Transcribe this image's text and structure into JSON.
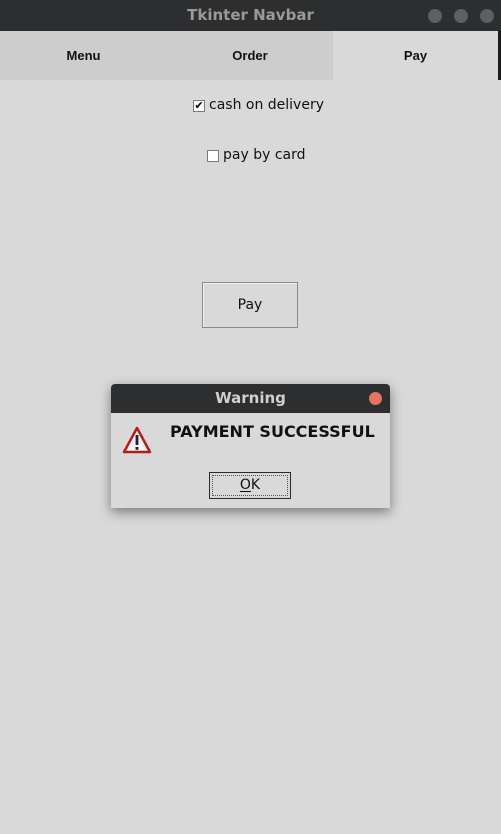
{
  "window": {
    "title": "Tkinter Navbar",
    "titlebar_color": "#2c2e30",
    "background_color": "#d9d9d9",
    "controls": [
      {
        "name": "minimize",
        "icon": "circle-icon"
      },
      {
        "name": "maximize",
        "icon": "circle-icon"
      },
      {
        "name": "close",
        "icon": "circle-icon"
      }
    ]
  },
  "tabs": [
    {
      "label": "Menu",
      "active": false
    },
    {
      "label": "Order",
      "active": false
    },
    {
      "label": "Pay",
      "active": true
    }
  ],
  "payment_options": [
    {
      "label": "cash on delivery",
      "checked": true
    },
    {
      "label": "pay by card",
      "checked": false
    }
  ],
  "pay_button": {
    "label": "Pay"
  },
  "dialog": {
    "title": "Warning",
    "message": "PAYMENT SUCCESSFUL",
    "icon": "warning-icon",
    "ok_button": {
      "label": "OK",
      "mnemonic": "O",
      "rest": "K"
    },
    "close_color": "#e9735e"
  }
}
